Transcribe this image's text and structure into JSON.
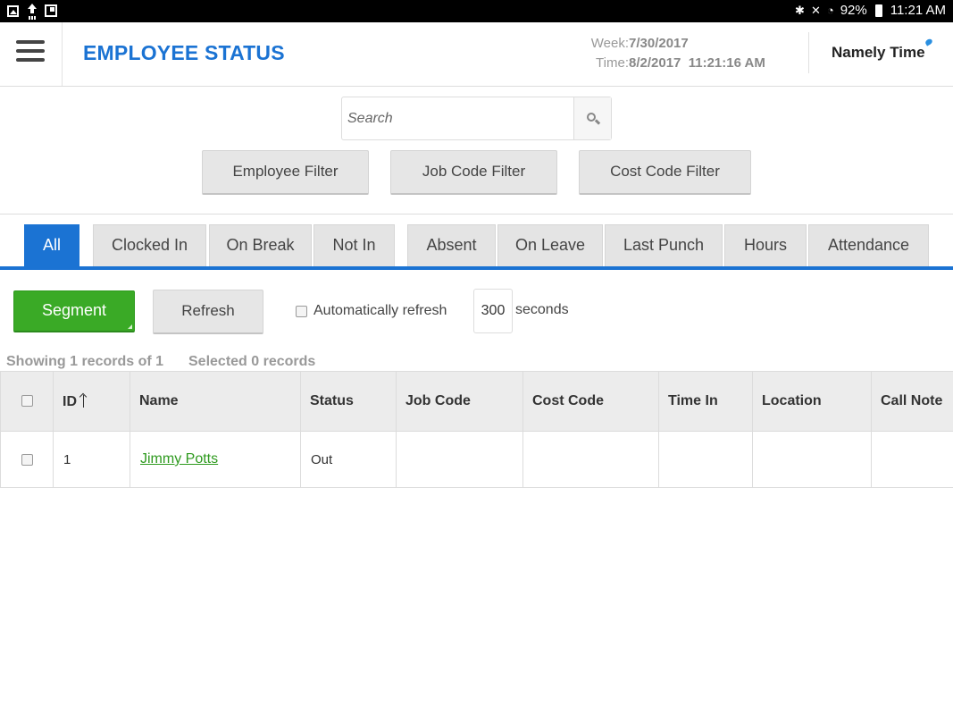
{
  "statusbar": {
    "battery": "92%",
    "time": "11:21 AM"
  },
  "header": {
    "title": "EMPLOYEE STATUS",
    "week_label": "Week:",
    "week_value": "7/30/2017",
    "time_label": "Time:",
    "time_value": "8/2/2017  11:21:16 AM",
    "brand": "Namely Time"
  },
  "search": {
    "placeholder": "Search"
  },
  "filters": {
    "employee": "Employee Filter",
    "job_code": "Job Code Filter",
    "cost_code": "Cost Code Filter"
  },
  "tabs": [
    "All",
    "Clocked In",
    "On Break",
    "Not In",
    "Absent",
    "On Leave",
    "Last Punch",
    "Hours",
    "Attendance"
  ],
  "active_tab": "All",
  "controls": {
    "segment_label": "Segment",
    "refresh_label": "Refresh",
    "auto_refresh_label": "Automatically refresh",
    "seconds_value": "300",
    "seconds_label": "seconds"
  },
  "records": {
    "showing": "Showing 1 records of 1",
    "selected": "Selected 0 records"
  },
  "table": {
    "columns": [
      "ID",
      "Name",
      "Status",
      "Job Code",
      "Cost Code",
      "Time In",
      "Location",
      "Call Note"
    ],
    "rows": [
      {
        "id": "1",
        "name": "Jimmy Potts",
        "status": "Out",
        "job_code": "",
        "cost_code": "",
        "time_in": "",
        "location": "",
        "call_note": ""
      }
    ]
  },
  "colors": {
    "accent": "#1b73d3",
    "segment_green": "#3aaa26",
    "link_green": "#2e9a1e"
  }
}
